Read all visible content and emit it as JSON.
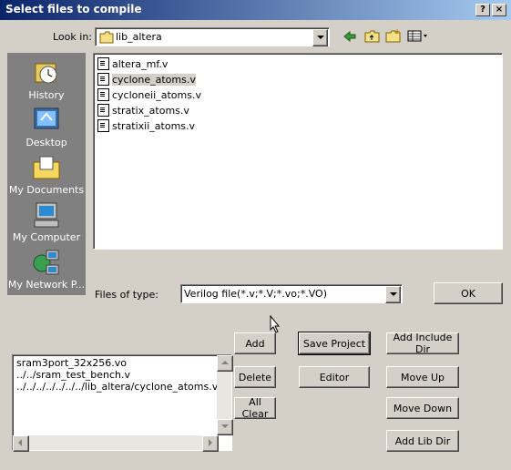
{
  "window": {
    "title": "Select files to compile",
    "help_button": "?",
    "close_button": "×"
  },
  "lookin": {
    "label": "Look in:",
    "value": "lib_altera"
  },
  "places": [
    {
      "label": "History",
      "icon": "history-icon"
    },
    {
      "label": "Desktop",
      "icon": "desktop-icon"
    },
    {
      "label": "My Documents",
      "icon": "my-documents-icon"
    },
    {
      "label": "My Computer",
      "icon": "my-computer-icon"
    },
    {
      "label": "My Network P...",
      "icon": "my-network-icon"
    }
  ],
  "files": [
    {
      "name": "altera_mf.v",
      "selected": false
    },
    {
      "name": "cyclone_atoms.v",
      "selected": true
    },
    {
      "name": "cycloneii_atoms.v",
      "selected": false
    },
    {
      "name": "stratix_atoms.v",
      "selected": false
    },
    {
      "name": "stratixii_atoms.v",
      "selected": false
    }
  ],
  "filetype": {
    "label": "Files of type:",
    "value": "Verilog file(*.v;*.V;*.vo;*.VO)"
  },
  "ok_label": "OK",
  "compile_list": [
    "sram3port_32x256.vo",
    "../../sram_test_bench.v",
    "../../../../../../../lib_altera/cyclone_atoms.v"
  ],
  "buttons": {
    "add": "Add",
    "delete": "Delete",
    "all_clear": "All Clear",
    "save_project": "Save Project",
    "editor": "Editor",
    "add_include_dir": "Add Include Dir",
    "move_up": "Move Up",
    "move_down": "Move Down",
    "add_lib_dir": "Add Lib Dir"
  },
  "colors": {
    "title_gradient_start": "#0a246a",
    "title_gradient_end": "#a6caf0",
    "dialog_bg": "#d4d0c8",
    "places_bg": "#808080"
  }
}
